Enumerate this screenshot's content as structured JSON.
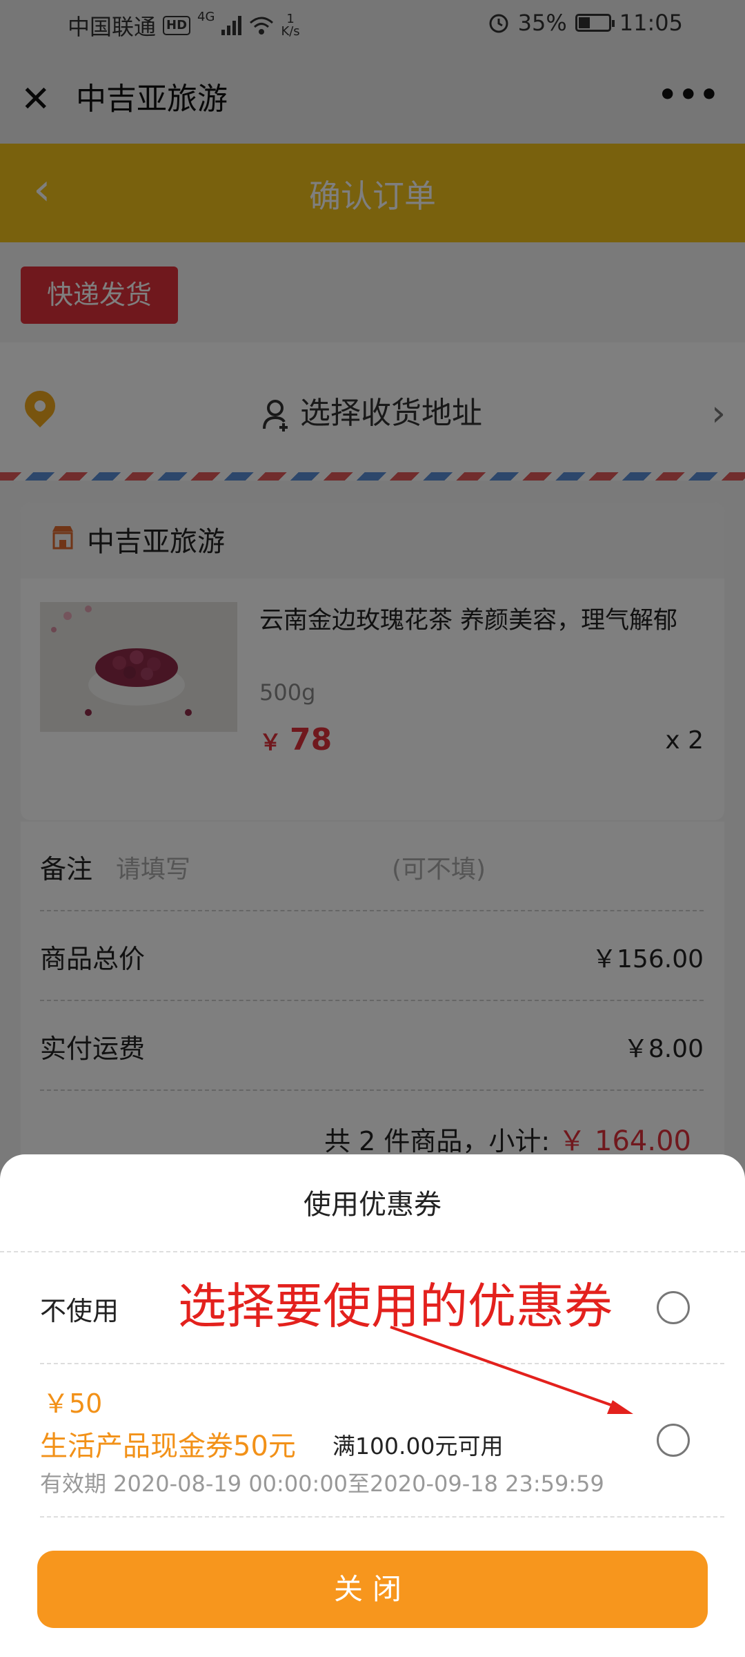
{
  "status_bar": {
    "carrier": "中国联通",
    "hd": "HD",
    "network": "4G",
    "speed_value": "1",
    "speed_unit": "K/s",
    "battery": "35%",
    "time": "11:05"
  },
  "wechat_bar": {
    "close": "✕",
    "title": "中吉亚旅游",
    "more": "•••"
  },
  "header": {
    "back": "‹",
    "title": "确认订单"
  },
  "shipping_tag": "快递发货",
  "address": {
    "placeholder": "选择收货地址",
    "chevron": "›"
  },
  "shop": {
    "name": "中吉亚旅游",
    "product": {
      "name": "云南金边玫瑰花茶 养颜美容，理气解郁",
      "spec": "500g",
      "currency": "￥",
      "price": "78",
      "qty": "x 2"
    }
  },
  "summary": {
    "remark_label": "备注",
    "remark_placeholder": "请填写",
    "remark_optional": "(可不填)",
    "goods_total_label": "商品总价",
    "goods_total_value": "￥156.00",
    "shipping_label": "实付运费",
    "shipping_value": "￥8.00",
    "subtotal_prefix": "共 2 件商品，小计: ",
    "subtotal_money": "￥ 164.00"
  },
  "coupon_sheet": {
    "title": "使用优惠券",
    "none_label": "不使用",
    "coupon": {
      "amount": "￥50",
      "name": "生活产品现金券50元",
      "condition": "满100.00元可用",
      "validity": "有效期 2020-08-19 00:00:00至2020-09-18 23:59:59"
    },
    "close_button": "关闭"
  },
  "annotation": "选择要使用的优惠券",
  "colors": {
    "header": "#f2c31a",
    "tag_red": "#e0303a",
    "price_red": "#e0303a",
    "coupon_orange": "#f29118",
    "button_orange": "#f7961d",
    "annotation_red": "#e3211d"
  }
}
